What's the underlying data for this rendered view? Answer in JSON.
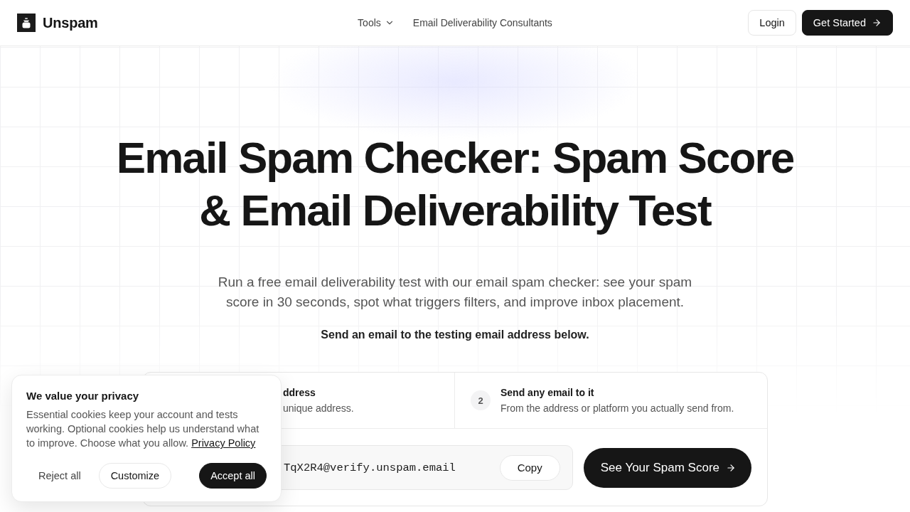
{
  "header": {
    "brand": "Unspam",
    "nav": [
      {
        "label": "Tools",
        "kind": "dropdown"
      },
      {
        "label": "Email Deliverability Consultants",
        "kind": "link"
      }
    ],
    "buttons": [
      {
        "label": "Login",
        "kind": "secondary"
      },
      {
        "label": "Get Started",
        "kind": "primary"
      }
    ]
  },
  "hero": {
    "title": "Email Spam Checker: Spam Score & Email Deliverability Test",
    "subtitle": "Run a free email deliverability test with our email spam checker: see your spam score in 30 seconds, spot what triggers filters, and improve inbox placement.",
    "instruction": "Send an email to the testing email address below."
  },
  "test_card": {
    "steps": [
      {
        "title": "ddress",
        "description": "unique address."
      },
      {
        "number": "2",
        "title": "Send any email to it",
        "description": "From the address or platform you actually send from."
      }
    ],
    "address": {
      "value": "TqX2R4@verify.unspam.email"
    },
    "copy_button": "Copy",
    "submit_button": "See Your Spam Score"
  },
  "cookie_banner": {
    "title": "We value your privacy",
    "text": "Essential cookies keep your account and tests working. Optional cookies help us understand what to improve. Choose what you allow.",
    "link": "Privacy Policy",
    "buttons": [
      {
        "label": "Reject all",
        "kind": "text"
      },
      {
        "label": "Customize",
        "kind": "outline"
      },
      {
        "label": "Accept all",
        "kind": "primary"
      }
    ]
  }
}
